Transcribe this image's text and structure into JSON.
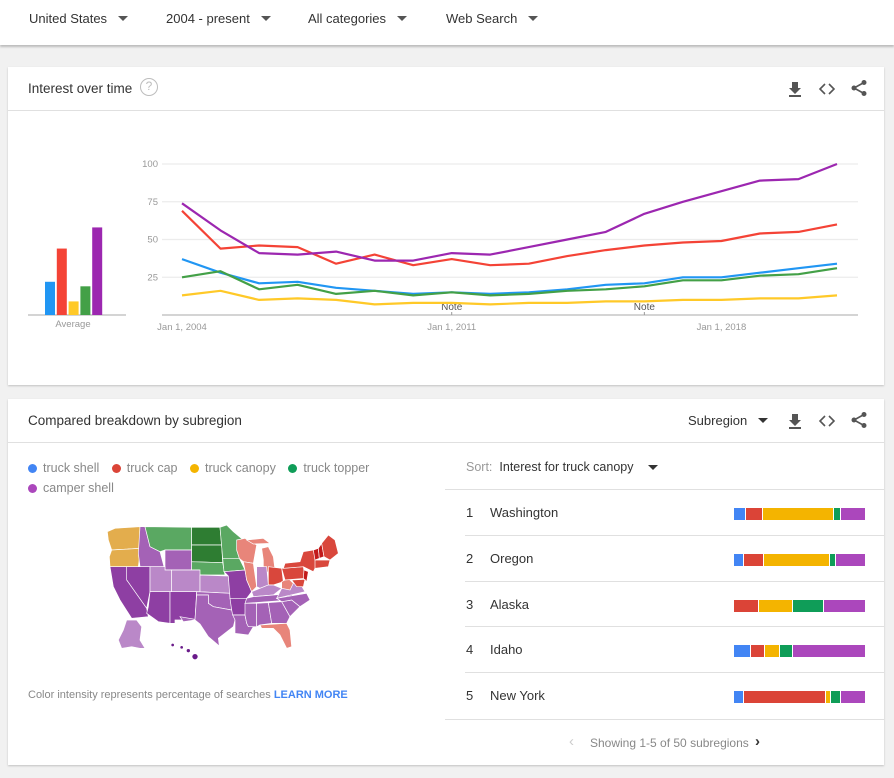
{
  "filters": [
    {
      "label": "United States"
    },
    {
      "label": "2004 - present"
    },
    {
      "label": "All categories"
    },
    {
      "label": "Web Search"
    }
  ],
  "interest_over_time": {
    "title": "Interest over time",
    "help": "?"
  },
  "colors": {
    "truck_shell": "#2196f3",
    "truck_cap": "#f44336",
    "truck_canopy": "#ffc928",
    "truck_topper": "#43a047",
    "camper_shell": "#9c27b0",
    "legend_truck_shell": "#4285f4",
    "legend_truck_cap": "#db4437",
    "legend_truck_canopy": "#f4b400",
    "legend_truck_topper": "#0f9d58",
    "legend_camper_shell": "#ab47bc",
    "link": "#4285f4"
  },
  "chart_data": {
    "type": "line",
    "title": "Interest over time",
    "x": [
      2004,
      2005,
      2006,
      2007,
      2008,
      2009,
      2010,
      2011,
      2012,
      2013,
      2014,
      2015,
      2016,
      2017,
      2018,
      2019,
      2020,
      2021
    ],
    "x_tick_labels": [
      "Jan 1, 2004",
      "Jan 1, 2011",
      "Jan 1, 2018"
    ],
    "x_tick_years": [
      2004,
      2011,
      2018
    ],
    "y_ticks": [
      25,
      50,
      75,
      100
    ],
    "ylim": [
      0,
      100
    ],
    "grid": true,
    "annotations": [
      {
        "year": 2011,
        "text": "Note"
      },
      {
        "year": 2016,
        "text": "Note"
      }
    ],
    "average_label": "Average",
    "series": [
      {
        "name": "truck shell",
        "key": "truck_shell",
        "average": 22,
        "values": [
          37,
          28,
          21,
          22,
          18,
          16,
          14,
          15,
          14,
          15,
          17,
          20,
          21,
          25,
          25,
          28,
          31,
          34
        ]
      },
      {
        "name": "truck cap",
        "key": "truck_cap",
        "average": 44,
        "values": [
          69,
          44,
          46,
          45,
          34,
          40,
          33,
          37,
          33,
          34,
          39,
          43,
          46,
          48,
          49,
          54,
          55,
          60
        ]
      },
      {
        "name": "truck canopy",
        "key": "truck_canopy",
        "average": 9,
        "values": [
          13,
          16,
          10,
          11,
          10,
          7,
          8,
          8,
          7,
          8,
          8,
          9,
          9,
          10,
          10,
          11,
          11,
          13
        ]
      },
      {
        "name": "truck topper",
        "key": "truck_topper",
        "average": 19,
        "values": [
          25,
          29,
          17,
          20,
          14,
          16,
          13,
          15,
          13,
          14,
          16,
          17,
          19,
          23,
          23,
          26,
          27,
          31
        ]
      },
      {
        "name": "camper shell",
        "key": "camper_shell",
        "average": 58,
        "values": [
          74,
          56,
          41,
          40,
          42,
          36,
          36,
          41,
          40,
          45,
          50,
          55,
          67,
          75,
          82,
          89,
          90,
          100
        ]
      }
    ]
  },
  "breakdown": {
    "title": "Compared breakdown by subregion",
    "subregion_select": "Subregion",
    "legend": [
      {
        "label": "truck shell",
        "color_key": "legend_truck_shell"
      },
      {
        "label": "truck cap",
        "color_key": "legend_truck_cap"
      },
      {
        "label": "truck canopy",
        "color_key": "legend_truck_canopy"
      },
      {
        "label": "truck topper",
        "color_key": "legend_truck_topper"
      },
      {
        "label": "camper shell",
        "color_key": "legend_camper_shell"
      }
    ],
    "footnote": "Color intensity represents percentage of searches",
    "learn_more": "LEARN MORE",
    "sort_label": "Sort:",
    "sort_value": "Interest for truck canopy",
    "rows": [
      {
        "rank": "1",
        "name": "Washington",
        "shares": [
          9,
          13,
          54,
          6,
          18
        ]
      },
      {
        "rank": "2",
        "name": "Oregon",
        "shares": [
          8,
          15,
          50,
          5,
          22
        ]
      },
      {
        "rank": "3",
        "name": "Alaska",
        "shares": [
          0,
          19,
          26,
          24,
          31
        ]
      },
      {
        "rank": "4",
        "name": "Idaho",
        "shares": [
          13,
          11,
          11,
          10,
          55
        ]
      },
      {
        "rank": "5",
        "name": "New York",
        "shares": [
          8,
          62,
          4,
          8,
          18
        ]
      }
    ],
    "pager_text": "Showing 1-5 of 50 subregions",
    "map_colors": {
      "canopy": "#e3ad4d",
      "topper": "#5aa862",
      "topper_dark": "#2e7d32",
      "cap_light": "#e8857a",
      "cap": "#d9473c",
      "cap_dark": "#c21a1a",
      "camper_dark": "#8e3fa3",
      "camper": "#a462b6",
      "camper_light": "#ba88c8",
      "camper_darkest": "#6a1b8a"
    }
  }
}
